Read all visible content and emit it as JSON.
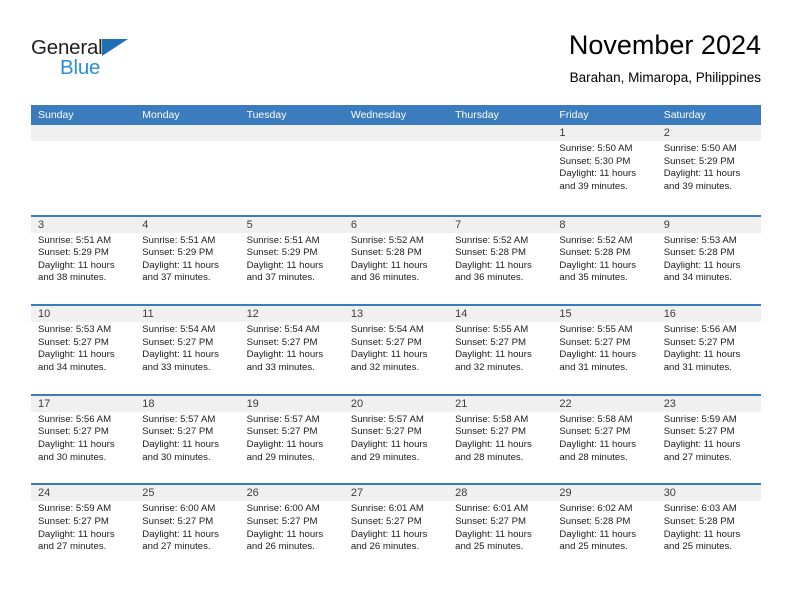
{
  "logo": {
    "word_one": "General",
    "word_two": "Blue",
    "triangle": "blue-triangle",
    "color_dark": "#231f20",
    "color_blue": "#2a8fd4"
  },
  "header": {
    "title": "November 2024",
    "location": "Barahan, Mimaropa, Philippines"
  },
  "theme": {
    "header_blue": "#3a7cbe",
    "date_band": "#f0f0f0",
    "text": "#1c1c1c"
  },
  "weekdays": [
    "Sunday",
    "Monday",
    "Tuesday",
    "Wednesday",
    "Thursday",
    "Friday",
    "Saturday"
  ],
  "weeks": [
    [
      {
        "day": "",
        "sunrise": "",
        "sunset": "",
        "daylight": ""
      },
      {
        "day": "",
        "sunrise": "",
        "sunset": "",
        "daylight": ""
      },
      {
        "day": "",
        "sunrise": "",
        "sunset": "",
        "daylight": ""
      },
      {
        "day": "",
        "sunrise": "",
        "sunset": "",
        "daylight": ""
      },
      {
        "day": "",
        "sunrise": "",
        "sunset": "",
        "daylight": ""
      },
      {
        "day": "1",
        "sunrise": "Sunrise: 5:50 AM",
        "sunset": "Sunset: 5:30 PM",
        "daylight": "Daylight: 11 hours and 39 minutes."
      },
      {
        "day": "2",
        "sunrise": "Sunrise: 5:50 AM",
        "sunset": "Sunset: 5:29 PM",
        "daylight": "Daylight: 11 hours and 39 minutes."
      }
    ],
    [
      {
        "day": "3",
        "sunrise": "Sunrise: 5:51 AM",
        "sunset": "Sunset: 5:29 PM",
        "daylight": "Daylight: 11 hours and 38 minutes."
      },
      {
        "day": "4",
        "sunrise": "Sunrise: 5:51 AM",
        "sunset": "Sunset: 5:29 PM",
        "daylight": "Daylight: 11 hours and 37 minutes."
      },
      {
        "day": "5",
        "sunrise": "Sunrise: 5:51 AM",
        "sunset": "Sunset: 5:29 PM",
        "daylight": "Daylight: 11 hours and 37 minutes."
      },
      {
        "day": "6",
        "sunrise": "Sunrise: 5:52 AM",
        "sunset": "Sunset: 5:28 PM",
        "daylight": "Daylight: 11 hours and 36 minutes."
      },
      {
        "day": "7",
        "sunrise": "Sunrise: 5:52 AM",
        "sunset": "Sunset: 5:28 PM",
        "daylight": "Daylight: 11 hours and 36 minutes."
      },
      {
        "day": "8",
        "sunrise": "Sunrise: 5:52 AM",
        "sunset": "Sunset: 5:28 PM",
        "daylight": "Daylight: 11 hours and 35 minutes."
      },
      {
        "day": "9",
        "sunrise": "Sunrise: 5:53 AM",
        "sunset": "Sunset: 5:28 PM",
        "daylight": "Daylight: 11 hours and 34 minutes."
      }
    ],
    [
      {
        "day": "10",
        "sunrise": "Sunrise: 5:53 AM",
        "sunset": "Sunset: 5:27 PM",
        "daylight": "Daylight: 11 hours and 34 minutes."
      },
      {
        "day": "11",
        "sunrise": "Sunrise: 5:54 AM",
        "sunset": "Sunset: 5:27 PM",
        "daylight": "Daylight: 11 hours and 33 minutes."
      },
      {
        "day": "12",
        "sunrise": "Sunrise: 5:54 AM",
        "sunset": "Sunset: 5:27 PM",
        "daylight": "Daylight: 11 hours and 33 minutes."
      },
      {
        "day": "13",
        "sunrise": "Sunrise: 5:54 AM",
        "sunset": "Sunset: 5:27 PM",
        "daylight": "Daylight: 11 hours and 32 minutes."
      },
      {
        "day": "14",
        "sunrise": "Sunrise: 5:55 AM",
        "sunset": "Sunset: 5:27 PM",
        "daylight": "Daylight: 11 hours and 32 minutes."
      },
      {
        "day": "15",
        "sunrise": "Sunrise: 5:55 AM",
        "sunset": "Sunset: 5:27 PM",
        "daylight": "Daylight: 11 hours and 31 minutes."
      },
      {
        "day": "16",
        "sunrise": "Sunrise: 5:56 AM",
        "sunset": "Sunset: 5:27 PM",
        "daylight": "Daylight: 11 hours and 31 minutes."
      }
    ],
    [
      {
        "day": "17",
        "sunrise": "Sunrise: 5:56 AM",
        "sunset": "Sunset: 5:27 PM",
        "daylight": "Daylight: 11 hours and 30 minutes."
      },
      {
        "day": "18",
        "sunrise": "Sunrise: 5:57 AM",
        "sunset": "Sunset: 5:27 PM",
        "daylight": "Daylight: 11 hours and 30 minutes."
      },
      {
        "day": "19",
        "sunrise": "Sunrise: 5:57 AM",
        "sunset": "Sunset: 5:27 PM",
        "daylight": "Daylight: 11 hours and 29 minutes."
      },
      {
        "day": "20",
        "sunrise": "Sunrise: 5:57 AM",
        "sunset": "Sunset: 5:27 PM",
        "daylight": "Daylight: 11 hours and 29 minutes."
      },
      {
        "day": "21",
        "sunrise": "Sunrise: 5:58 AM",
        "sunset": "Sunset: 5:27 PM",
        "daylight": "Daylight: 11 hours and 28 minutes."
      },
      {
        "day": "22",
        "sunrise": "Sunrise: 5:58 AM",
        "sunset": "Sunset: 5:27 PM",
        "daylight": "Daylight: 11 hours and 28 minutes."
      },
      {
        "day": "23",
        "sunrise": "Sunrise: 5:59 AM",
        "sunset": "Sunset: 5:27 PM",
        "daylight": "Daylight: 11 hours and 27 minutes."
      }
    ],
    [
      {
        "day": "24",
        "sunrise": "Sunrise: 5:59 AM",
        "sunset": "Sunset: 5:27 PM",
        "daylight": "Daylight: 11 hours and 27 minutes."
      },
      {
        "day": "25",
        "sunrise": "Sunrise: 6:00 AM",
        "sunset": "Sunset: 5:27 PM",
        "daylight": "Daylight: 11 hours and 27 minutes."
      },
      {
        "day": "26",
        "sunrise": "Sunrise: 6:00 AM",
        "sunset": "Sunset: 5:27 PM",
        "daylight": "Daylight: 11 hours and 26 minutes."
      },
      {
        "day": "27",
        "sunrise": "Sunrise: 6:01 AM",
        "sunset": "Sunset: 5:27 PM",
        "daylight": "Daylight: 11 hours and 26 minutes."
      },
      {
        "day": "28",
        "sunrise": "Sunrise: 6:01 AM",
        "sunset": "Sunset: 5:27 PM",
        "daylight": "Daylight: 11 hours and 25 minutes."
      },
      {
        "day": "29",
        "sunrise": "Sunrise: 6:02 AM",
        "sunset": "Sunset: 5:28 PM",
        "daylight": "Daylight: 11 hours and 25 minutes."
      },
      {
        "day": "30",
        "sunrise": "Sunrise: 6:03 AM",
        "sunset": "Sunset: 5:28 PM",
        "daylight": "Daylight: 11 hours and 25 minutes."
      }
    ]
  ]
}
